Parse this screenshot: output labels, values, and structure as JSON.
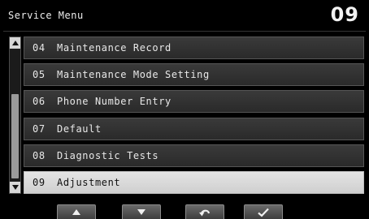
{
  "header": {
    "title": "Service Menu",
    "code": "09"
  },
  "menu": {
    "items": [
      {
        "num": "04",
        "label": "Maintenance Record",
        "selected": false
      },
      {
        "num": "05",
        "label": "Maintenance Mode Setting",
        "selected": false
      },
      {
        "num": "06",
        "label": "Phone Number Entry",
        "selected": false
      },
      {
        "num": "07",
        "label": "Default",
        "selected": false
      },
      {
        "num": "08",
        "label": "Diagnostic Tests",
        "selected": false
      },
      {
        "num": "09",
        "label": "Adjustment",
        "selected": true
      }
    ]
  },
  "footer": {
    "buttons": [
      {
        "icon": "arrow-up-icon"
      },
      {
        "icon": "arrow-down-icon"
      },
      {
        "icon": "back-icon"
      },
      {
        "icon": "check-icon"
      }
    ]
  },
  "colors": {
    "background": "#000000",
    "row": "#333333",
    "row_selected": "#d8d8d8",
    "text": "#e8e8e8"
  }
}
